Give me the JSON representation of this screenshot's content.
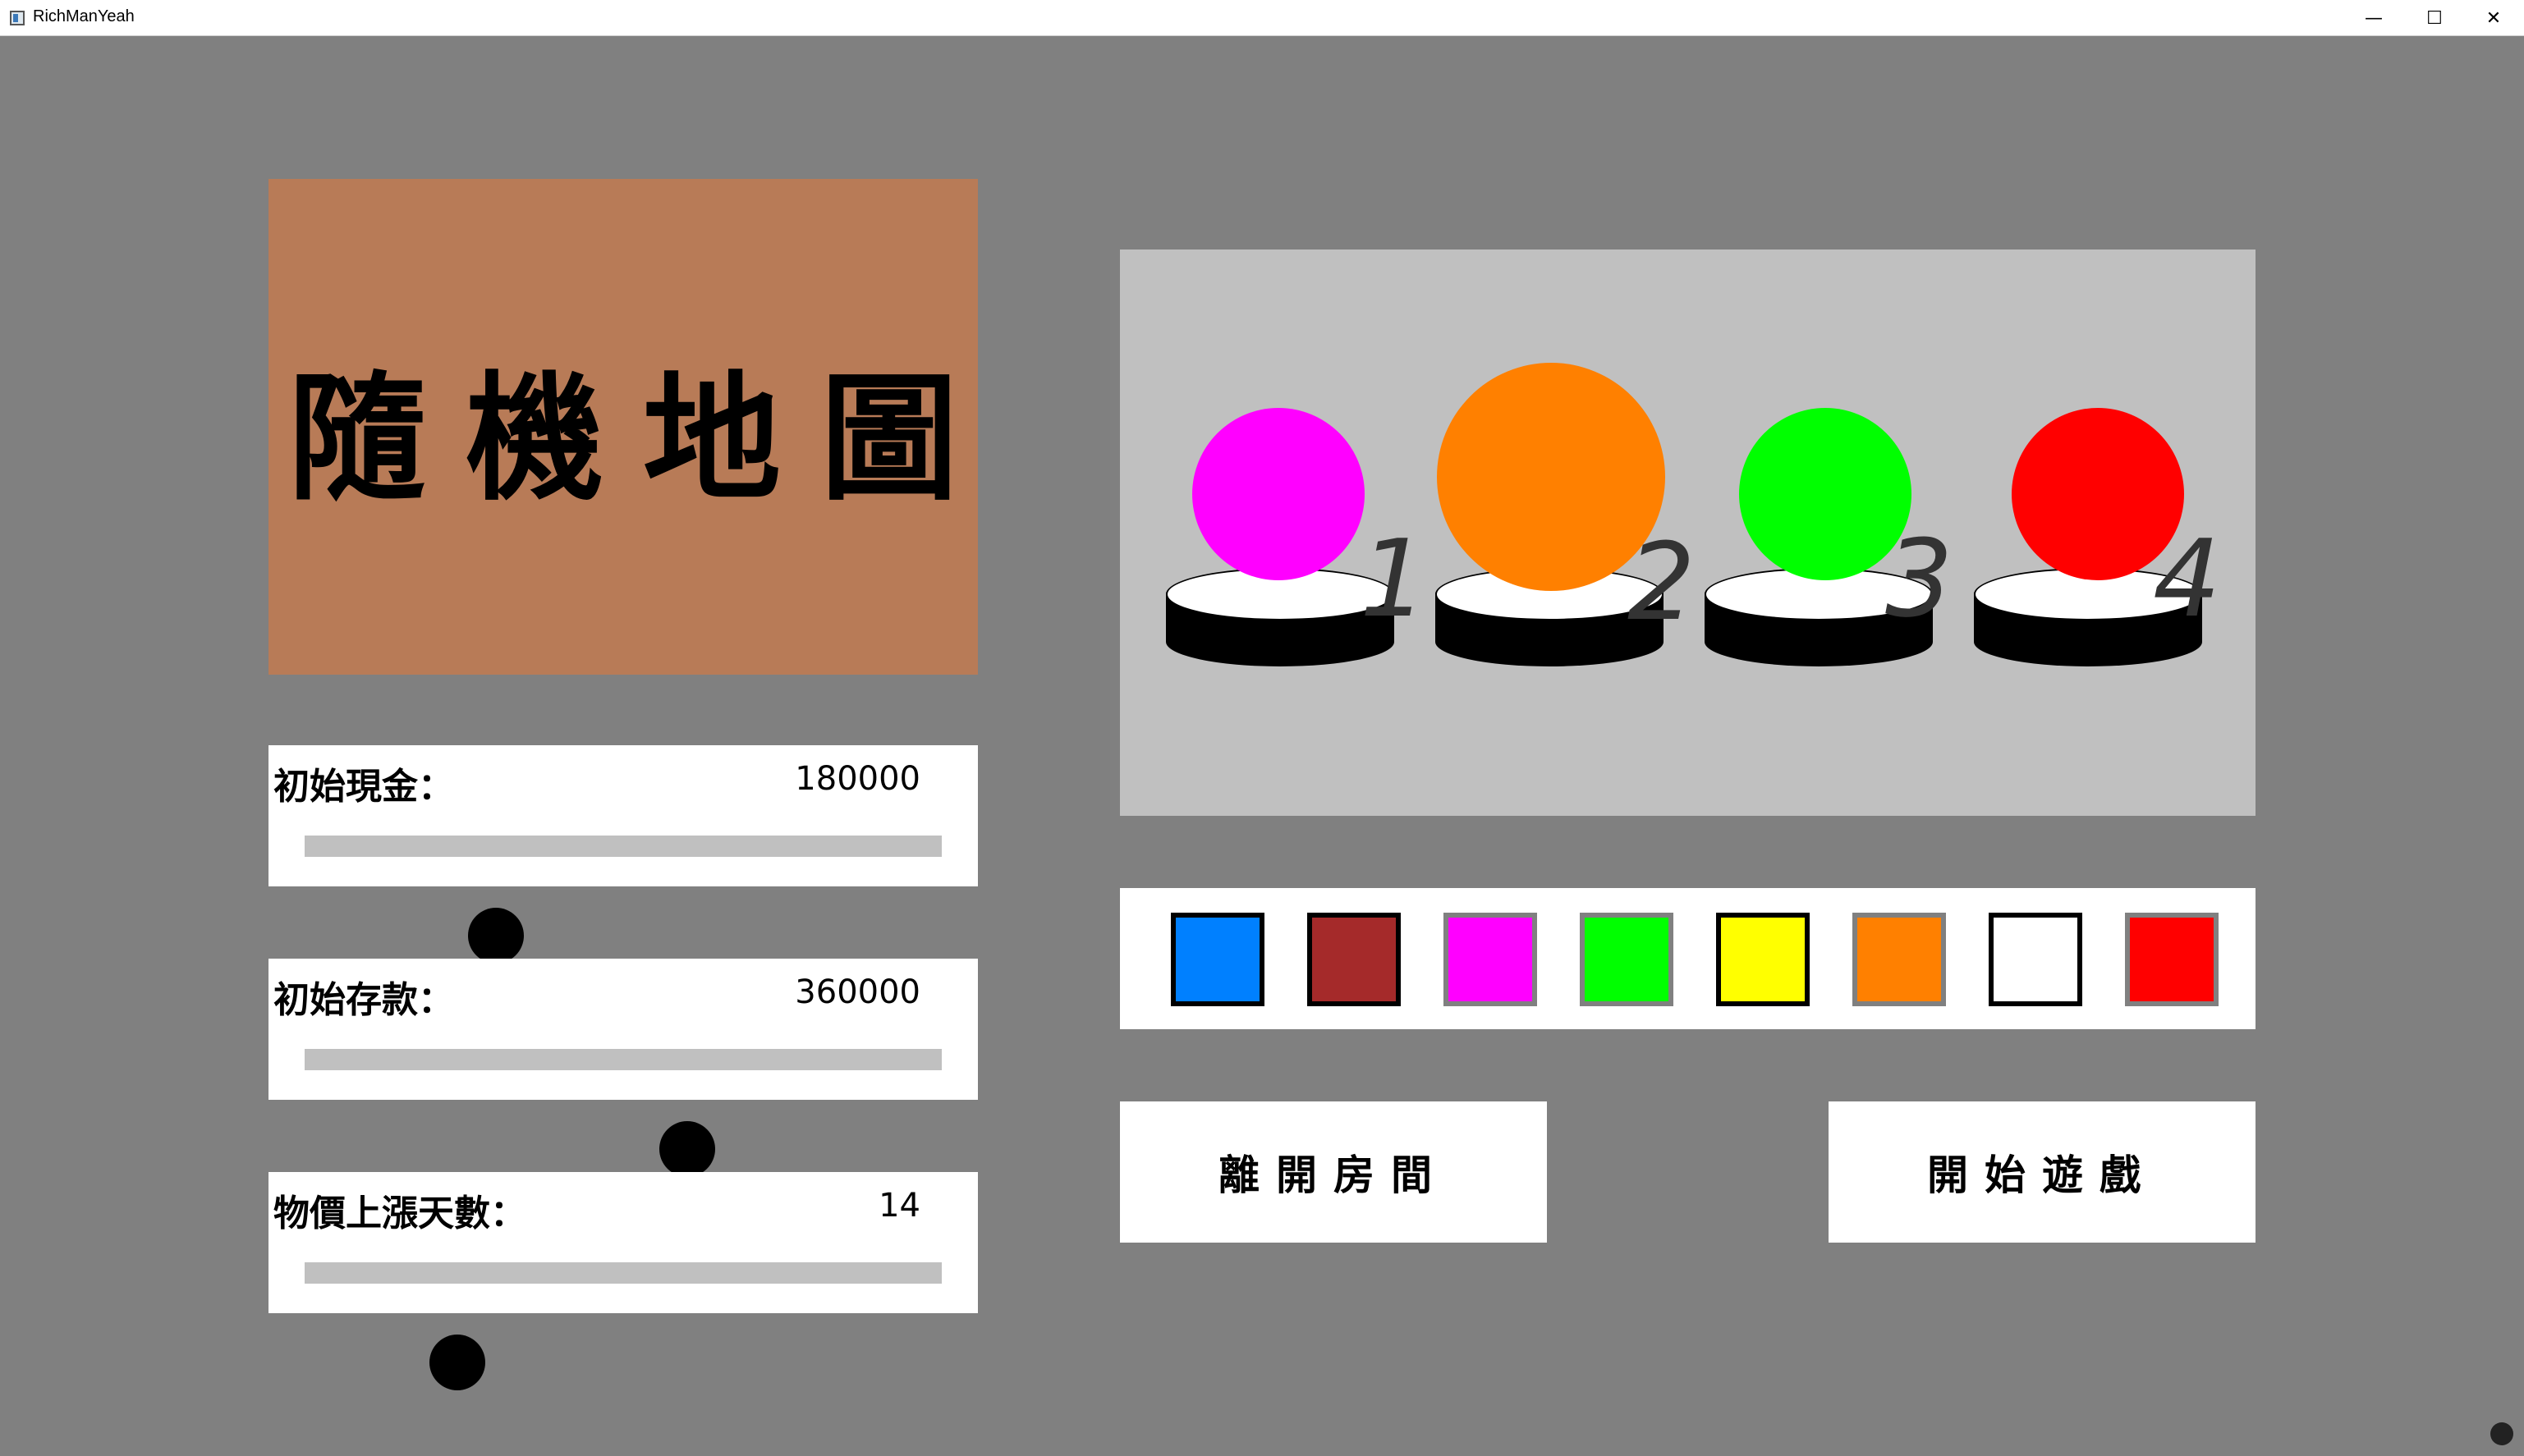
{
  "window": {
    "title": "RichManYeah",
    "minimize_icon": "—",
    "maximize_icon": "☐",
    "close_icon": "✕"
  },
  "map": {
    "title": "隨機地圖",
    "background": "#b87b57"
  },
  "sliders": [
    {
      "label": "初始現金：",
      "value": "180000",
      "fraction": 0.3
    },
    {
      "label": "初始存款：",
      "value": "360000",
      "fraction": 0.6
    },
    {
      "label": "物價上漲天數：",
      "value": "14",
      "fraction": 0.24
    }
  ],
  "players": [
    {
      "number": "1",
      "color": "#ff00ff"
    },
    {
      "number": "2",
      "color": "#ff8000"
    },
    {
      "number": "3",
      "color": "#00ff00"
    },
    {
      "number": "4",
      "color": "#ff0000"
    }
  ],
  "color_options": [
    {
      "name": "blue",
      "color": "#0080ff",
      "border": "#000000"
    },
    {
      "name": "brown",
      "color": "#a52a2a",
      "border": "#000000"
    },
    {
      "name": "magenta",
      "color": "#ff00ff",
      "border": "#808080"
    },
    {
      "name": "green",
      "color": "#00ff00",
      "border": "#808080"
    },
    {
      "name": "yellow",
      "color": "#ffff00",
      "border": "#000000"
    },
    {
      "name": "orange",
      "color": "#ff8000",
      "border": "#808080"
    },
    {
      "name": "white",
      "color": "#ffffff",
      "border": "#000000"
    },
    {
      "name": "red",
      "color": "#ff0000",
      "border": "#808080"
    }
  ],
  "buttons": {
    "leave_room": "離開房間",
    "start_game": "開始遊戲"
  }
}
